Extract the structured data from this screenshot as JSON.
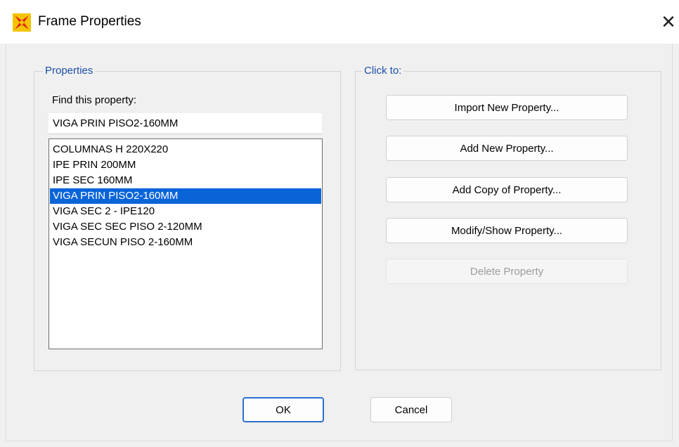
{
  "window": {
    "title": "Frame Properties",
    "icon": "sap-x-logo-icon",
    "close_glyph": "✕"
  },
  "properties_group": {
    "legend": "Properties",
    "find_label": "Find this property:",
    "find_value": "VIGA PRIN PISO2-160MM",
    "items": [
      {
        "label": "COLUMNAS H 220X220",
        "selected": false
      },
      {
        "label": "IPE PRIN 200MM",
        "selected": false
      },
      {
        "label": "IPE SEC 160MM",
        "selected": false
      },
      {
        "label": "VIGA PRIN PISO2-160MM",
        "selected": true
      },
      {
        "label": "VIGA SEC 2 - IPE120",
        "selected": false
      },
      {
        "label": "VIGA SEC SEC PISO 2-120MM",
        "selected": false
      },
      {
        "label": "VIGA SECUN PISO 2-160MM",
        "selected": false
      }
    ]
  },
  "actions_group": {
    "legend": "Click to:",
    "buttons": [
      {
        "label": "Import New Property...",
        "enabled": true
      },
      {
        "label": "Add New Property...",
        "enabled": true
      },
      {
        "label": "Add Copy of Property...",
        "enabled": true
      },
      {
        "label": "Modify/Show Property...",
        "enabled": true
      },
      {
        "label": "Delete Property",
        "enabled": false
      }
    ]
  },
  "footer": {
    "ok_label": "OK",
    "cancel_label": "Cancel"
  },
  "colors": {
    "selection": "#0a64d8",
    "legend_text": "#1c4fa8",
    "default_button_border": "#2c6fd0",
    "icon_yellow": "#f5c400",
    "icon_red": "#e0231b"
  }
}
